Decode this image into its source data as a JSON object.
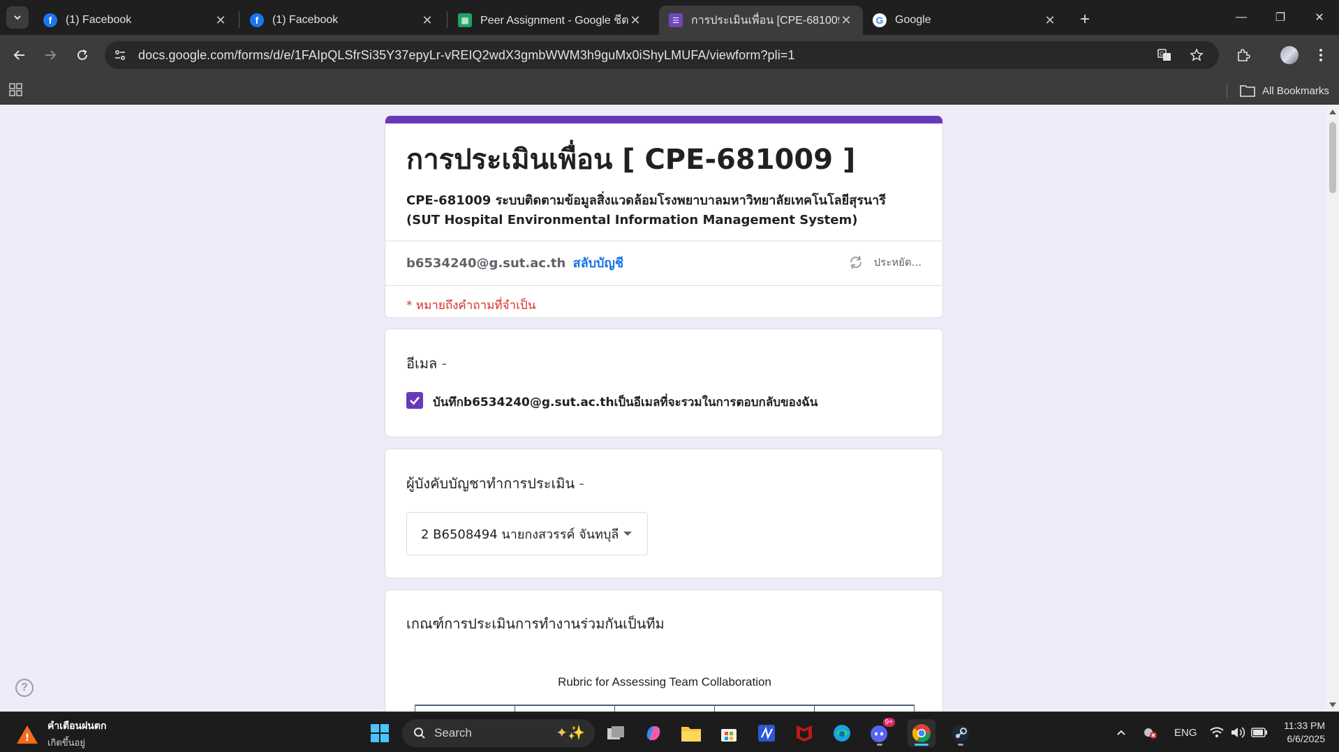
{
  "browser": {
    "tabs": [
      {
        "title": "(1) Facebook",
        "icon": "facebook-icon",
        "active": false
      },
      {
        "title": "(1) Facebook",
        "icon": "facebook-icon",
        "active": false
      },
      {
        "title": "Peer Assignment - Google ชีต",
        "icon": "google-sheets-icon",
        "active": false
      },
      {
        "title": "การประเมินเพื่อน [CPE-681009]",
        "icon": "google-forms-icon",
        "active": true
      },
      {
        "title": "Google",
        "icon": "google-icon",
        "active": false
      }
    ],
    "url": "docs.google.com/forms/d/e/1FAIpQLSfrSi35Y37epyLr-vREIQ2wdX3gmbWWM3h9guMx0iShyLMUFA/viewform?pli=1",
    "bookmarks": {
      "all_label": "All Bookmarks"
    }
  },
  "form": {
    "title": "การประเมินเพื่อน [ CPE-681009 ]",
    "description_line1": "CPE-681009 ระบบติดตามข้อมูลสิ่งแวดล้อมโรงพยาบาลมหาวิทยาลัยเทคโนโลยีสุรนารี",
    "description_line2": "(SUT Hospital Environmental Information Management System)",
    "account_email": "b6534240@g.sut.ac.th",
    "switch_account": "สลับบัญชี",
    "saving_status": "ประหยัด...",
    "required_note": "* หมายถึงคำถามที่จำเป็น",
    "accent_color": "#673ab7",
    "questions": {
      "email": {
        "label": "อีเมล",
        "dash": "-",
        "checkbox_label": "บันทึกb6534240@g.sut.ac.thเป็นอีเมลที่จะรวมในการตอบกลับของฉัน",
        "checked": true
      },
      "supervisor": {
        "label": "ผู้บังคับบัญชาทำการประเมิน",
        "dash": "-",
        "selected_value": "2 B6508494 นายกงสวรรค์ จันทบุลี"
      },
      "rubric": {
        "label": "เกณฑ์การประเมินการทำงานร่วมกันเป็นทีม",
        "image_title": "Rubric for Assessing Team Collaboration"
      }
    }
  },
  "taskbar": {
    "weather_title": "คำเตือนฝนตก",
    "weather_subtitle": "เกิดขึ้นอยู่",
    "search_placeholder": "Search",
    "language": "ENG",
    "time": "11:33 PM",
    "date": "6/6/2025",
    "discord_badge": "9+"
  }
}
